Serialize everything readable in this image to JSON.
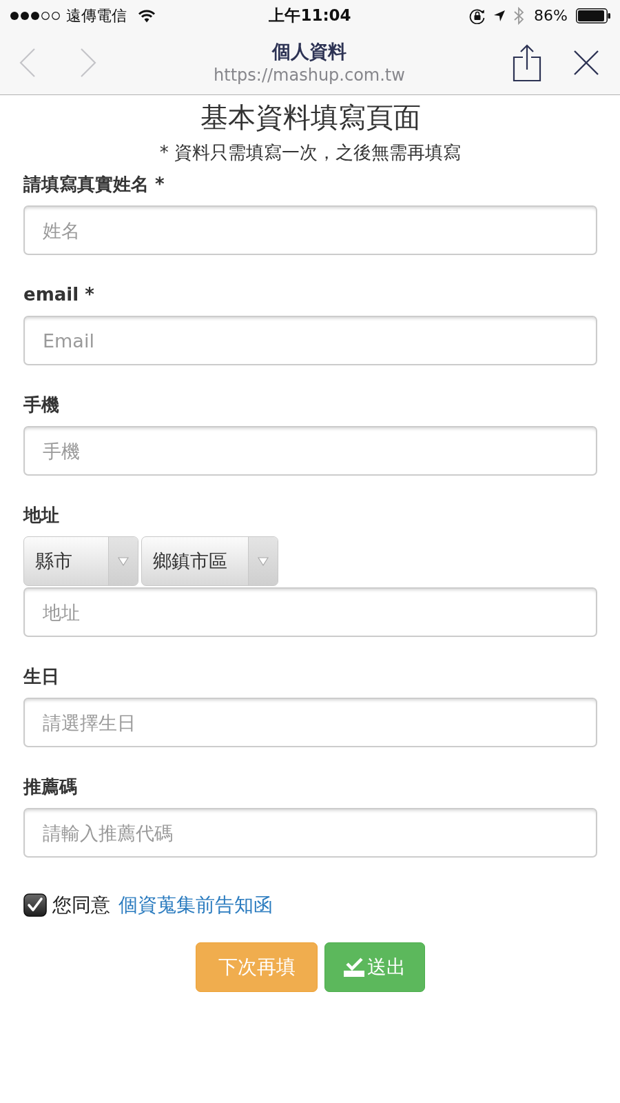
{
  "status_bar": {
    "carrier": "遠傳電信",
    "time": "上午11:04",
    "battery": "86%"
  },
  "browser": {
    "title": "個人資料",
    "url": "https://mashup.com.tw",
    "back": {
      "disabled": true
    },
    "forward": {
      "disabled": true
    }
  },
  "page": {
    "heading": "基本資料填寫頁面",
    "note": "* 資料只需填寫一次，之後無需再填寫"
  },
  "fields": [
    {
      "kind": "text",
      "label": "請填寫真實姓名 *",
      "placeholder": "姓名"
    },
    {
      "kind": "text",
      "label": "email *",
      "placeholder": "Email"
    },
    {
      "kind": "text",
      "label": "手機",
      "placeholder": "手機"
    },
    {
      "kind": "address",
      "label": "地址",
      "selects": [
        {
          "value": "縣市"
        },
        {
          "value": "鄉鎮市區"
        }
      ],
      "placeholder": "地址"
    },
    {
      "kind": "text",
      "label": "生日",
      "placeholder": "請選擇生日"
    },
    {
      "kind": "text",
      "label": "推薦碼",
      "placeholder": "請輸入推薦代碼"
    }
  ],
  "consent": {
    "checked": true,
    "text": "您同意",
    "link": "個資蒐集前告知函"
  },
  "buttons": [
    {
      "kind": "later",
      "label": "下次再填"
    },
    {
      "kind": "submit",
      "label": "送出"
    }
  ]
}
